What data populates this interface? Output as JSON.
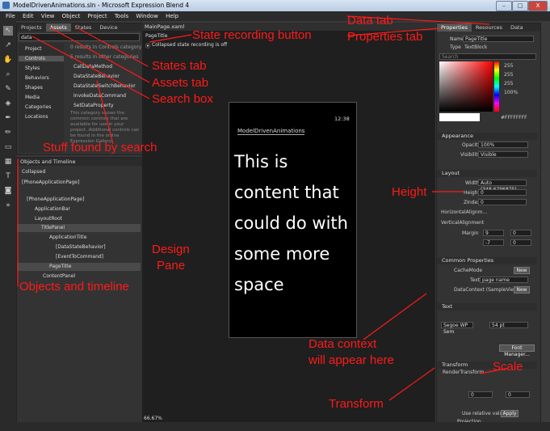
{
  "window": {
    "title": "ModelDrivenAnimations.sln - Microsoft Expression Blend 4",
    "minimize": "–",
    "maximize": "□",
    "close": "X"
  },
  "menu": [
    "File",
    "Edit",
    "View",
    "Object",
    "Project",
    "Tools",
    "Window",
    "Help"
  ],
  "left_panel": {
    "tabs": [
      "Projects",
      "Assets",
      "States",
      "Device"
    ],
    "search_value": "data",
    "categories": [
      "Project",
      "Controls",
      "Styles",
      "Behaviors",
      "Shapes",
      "Media",
      "Categories",
      "Locations"
    ],
    "results_header": "0 results in Controls category",
    "results_sub": "5 results in other categories",
    "results": [
      "CallDataMethod",
      "DataStateBehavior",
      "DataStateSwitchBehavior",
      "InvokeDataCommand",
      "SetDataProperty"
    ],
    "hint": "This category shows the common controls that are available for use in your project. Additional controls can be found in the online Expression Gallery."
  },
  "objects_panel": {
    "title": "Objects and Timeline",
    "state": "Collapsed",
    "root": "[PhoneApplicationPage]",
    "items": [
      "[PhoneApplicationPage]",
      "ApplicationBar",
      "LayoutRoot",
      "TitlePanel",
      "ApplicationTitle",
      "[DataStateBehavior]",
      "[EventToCommand]",
      "PageTitle",
      "ContentPanel"
    ]
  },
  "document": {
    "tab": "MainPage.xaml",
    "breadcrumb": "PageTitle",
    "recording": "Collapsed state recording is off",
    "phone_time": "12:38",
    "app_title": "ModelDrivenAnimations",
    "content_text": "This is content that could do with some more space",
    "zoom": "66.67%"
  },
  "properties": {
    "tabs": [
      "Properties",
      "Resources",
      "Data"
    ],
    "name_label": "Name",
    "name_value": "PageTitle",
    "type_label": "Type",
    "type_value": "TextBlock",
    "search_placeholder": "Search",
    "color_values": [
      "255",
      "255",
      "255",
      "100%"
    ],
    "color_hex": "#FFFFFFFF",
    "appearance": {
      "title": "Appearance",
      "opacity_label": "Opacity",
      "opacity": "100%",
      "visibility_label": "Visibility",
      "visibility": "Visible"
    },
    "layout": {
      "title": "Layout",
      "width_label": "Width",
      "width": "Auto (348.6796875)",
      "height_label": "Height",
      "height": "0",
      "zindex_label": "ZIndex",
      "zindex": "0",
      "halign_label": "HorizontalAlignm...",
      "valign_label": "VerticalAlignment",
      "margin_label": "Margin",
      "margins": [
        "9",
        "0",
        "-7",
        "0"
      ]
    },
    "common": {
      "title": "Common Properties",
      "cachemode_label": "CacheMode",
      "new_label": "New",
      "text_label": "Text",
      "text_value": "page name",
      "datacontext_label": "DataContext (SampleView..."
    },
    "text": {
      "title": "Text",
      "font": "Segoe WP Sem",
      "size": "54 pt",
      "font_manager": "Font Manager..."
    },
    "transform": {
      "title": "Transform",
      "render_label": "RenderTransform",
      "vals": [
        "0",
        "0"
      ],
      "relative": "Use relative values",
      "apply": "Apply"
    },
    "projection": "Projection"
  },
  "annotations": {
    "state_recording": "State recording button",
    "data_tab": "Data tab",
    "properties_tab": "Properties tab",
    "states_tab": "States tab",
    "assets_tab": "Assets tab",
    "search_box": "Search box",
    "stuff_found": "Stuff found by search",
    "objects_timeline": "Objects and timeline",
    "design_pane_1": "Design",
    "design_pane_2": "Pane",
    "height": "Height",
    "data_context_1": "Data context",
    "data_context_2": "will appear here",
    "scale": "Scale",
    "transform": "Transform",
    "annotation_color": "#ff1a1a"
  }
}
